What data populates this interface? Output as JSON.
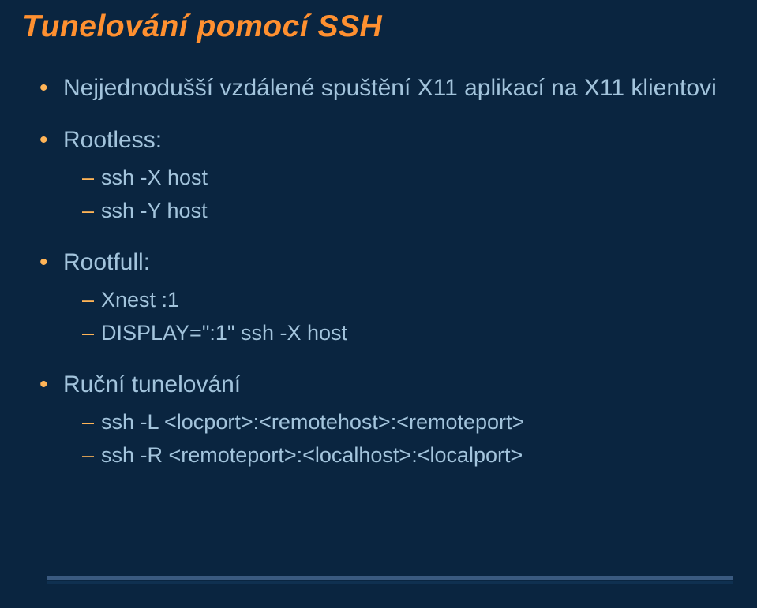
{
  "title": "Tunelování pomocí SSH",
  "bullets": [
    {
      "text": "Nejjednodušší vzdálené spuštění X11 aplikací na X11 klientovi",
      "sub": []
    },
    {
      "text": "Rootless:",
      "sub": [
        "ssh -X host",
        "ssh -Y host"
      ]
    },
    {
      "text": "Rootfull:",
      "sub": [
        "Xnest :1",
        "DISPLAY=\":1\" ssh -X host"
      ]
    },
    {
      "text": "Ruční tunelování",
      "sub": [
        "ssh -L <locport>:<remotehost>:<remoteport>",
        "ssh -R <remoteport>:<localhost>:<localport>"
      ]
    }
  ]
}
